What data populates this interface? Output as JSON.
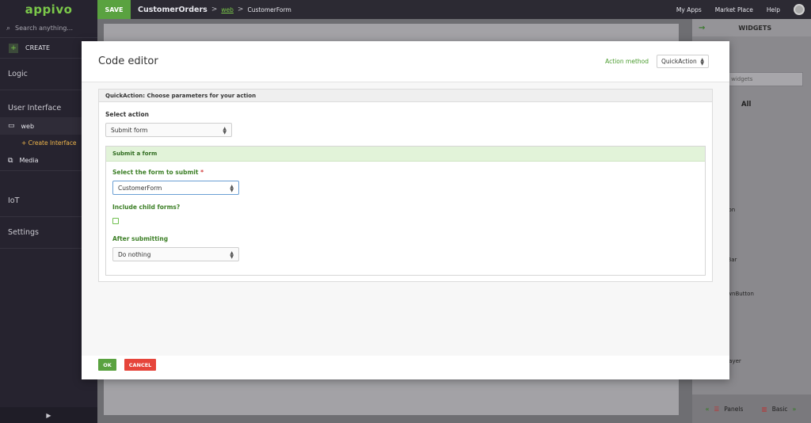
{
  "sidebar": {
    "logo": "appivo",
    "search_placeholder": "Search anything...",
    "create_label": "CREATE",
    "logic_label": "Logic",
    "ui_label": "User Interface",
    "web_label": "web",
    "create_interface_label": "+ Create Interface",
    "media_label": "Media",
    "iot_label": "IoT",
    "settings_label": "Settings",
    "play_icon": "▶"
  },
  "topbar": {
    "save_label": "SAVE",
    "app_name": "CustomerOrders",
    "sep": ">",
    "web_link": "web",
    "page_name": "CustomerForm",
    "my_apps": "My Apps",
    "market_place": "Market Place",
    "help": "Help"
  },
  "widgets": {
    "title": "WIDGETS",
    "search_placeholder": "r widgets",
    "all_label": "All",
    "items": [
      "r",
      "tron",
      "n",
      "nBar",
      "ownButton",
      "Player"
    ],
    "panels_label": "Panels",
    "basic_label": "Basic"
  },
  "modal": {
    "title": "Code editor",
    "action_method_label": "Action method",
    "action_method_value": "QuickAction",
    "panel_title": "QuickAction: Choose parameters for your action",
    "select_action_label": "Select action",
    "select_action_value": "Submit form",
    "submit_form_title": "Submit a form",
    "select_form_label": "Select the form to submit",
    "required_mark": "*",
    "select_form_value": "CustomerForm",
    "include_child_label": "Include child forms?",
    "include_child_checked": false,
    "after_submitting_label": "After submitting",
    "after_submitting_value": "Do nothing",
    "ok_label": "OK",
    "cancel_label": "CANCEL"
  },
  "colors": {
    "brand_green": "#5aa240",
    "accent_green_text": "#3c7f26",
    "cancel_red": "#e6453b",
    "sidebar_bg": "#26232f"
  }
}
